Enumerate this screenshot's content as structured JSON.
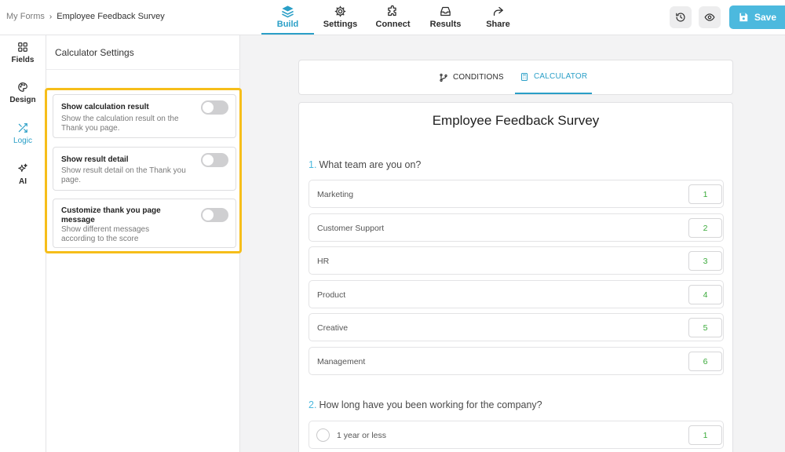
{
  "breadcrumb": {
    "root": "My Forms",
    "separator": "›",
    "current": "Employee Feedback Survey"
  },
  "nav": [
    {
      "label": "Build",
      "icon": "layers-icon",
      "active": true
    },
    {
      "label": "Settings",
      "icon": "gear-icon",
      "active": false
    },
    {
      "label": "Connect",
      "icon": "puzzle-icon",
      "active": false
    },
    {
      "label": "Results",
      "icon": "inbox-icon",
      "active": false
    },
    {
      "label": "Share",
      "icon": "share-arrow-icon",
      "active": false
    }
  ],
  "actions": {
    "history_icon": "history-icon",
    "preview_icon": "eye-icon",
    "save_label": "Save"
  },
  "rail": [
    {
      "label": "Fields",
      "icon": "grid-icon"
    },
    {
      "label": "Design",
      "icon": "palette-icon"
    },
    {
      "label": "Logic",
      "icon": "shuffle-icon",
      "active": true
    },
    {
      "label": "AI",
      "icon": "sparkle-icon"
    }
  ],
  "panel": {
    "title": "Calculator Settings",
    "settings": [
      {
        "title": "Show calculation result",
        "description": "Show the calculation result on the Thank you page.",
        "enabled": false
      },
      {
        "title": "Show result detail",
        "description": "Show result detail on the Thank you page.",
        "enabled": false
      },
      {
        "title": "Customize thank you page message",
        "description": "Show different messages according to the score",
        "enabled": false
      }
    ]
  },
  "tabs": [
    {
      "label": "CONDITIONS",
      "icon": "branch-icon",
      "active": false
    },
    {
      "label": "CALCULATOR",
      "icon": "calculator-icon",
      "active": true
    }
  ],
  "form": {
    "title": "Employee Feedback Survey",
    "questions": [
      {
        "number": "1.",
        "text": "What team are you on?",
        "options": [
          {
            "label": "Marketing",
            "score": "1"
          },
          {
            "label": "Customer Support",
            "score": "2"
          },
          {
            "label": "HR",
            "score": "3"
          },
          {
            "label": "Product",
            "score": "4"
          },
          {
            "label": "Creative",
            "score": "5"
          },
          {
            "label": "Management",
            "score": "6"
          }
        ]
      },
      {
        "number": "2.",
        "text": "How long have you been working for the company?",
        "options": [
          {
            "label": "1 year or less",
            "score": "1"
          }
        ]
      }
    ]
  },
  "colors": {
    "accent": "#2a9fc7",
    "save": "#4cb9de",
    "highlight": "#f6be1a",
    "score": "#3aaa3a"
  }
}
